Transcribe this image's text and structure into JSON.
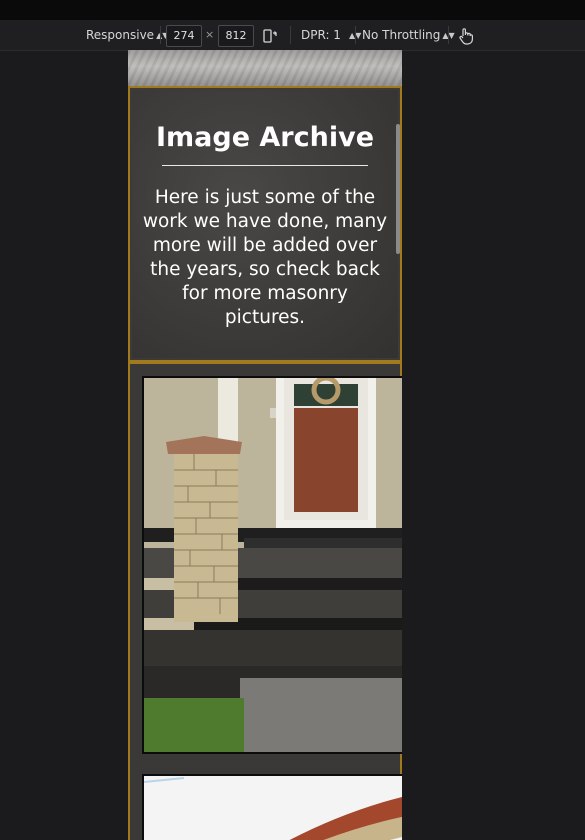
{
  "devtools": {
    "device_mode": "Responsive",
    "width": "274",
    "times": "×",
    "height": "812",
    "dpr": "DPR: 1",
    "throttling": "No Throttling"
  },
  "page": {
    "heading": "Image Archive",
    "description": "Here is just some of the work we have done, many more will be added over the years, so check back for more masonry pictures."
  },
  "colors": {
    "gold_border": "#a07a1c",
    "panel_bg": "#3c3a38",
    "devtools_bg": "#1b1b1d"
  },
  "icons": {
    "rotate": "rotate-device-icon",
    "touch": "touch-hand-icon"
  }
}
